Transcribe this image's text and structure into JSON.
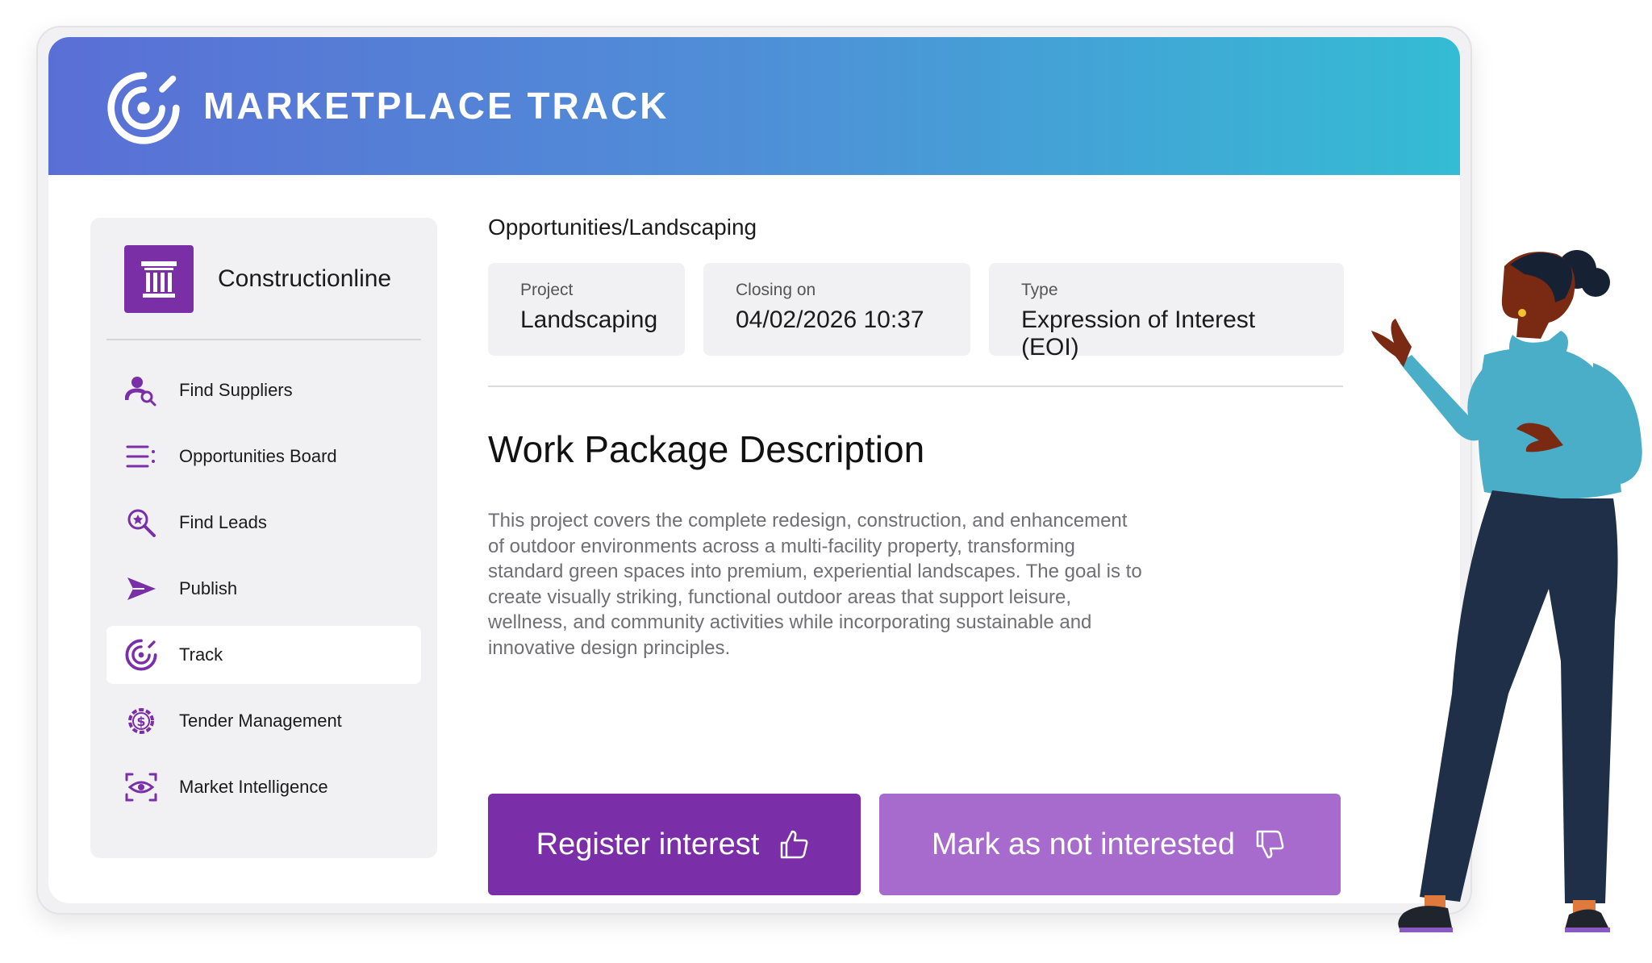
{
  "header": {
    "title": "MARKETPLACE TRACK",
    "logo_icon": "track-target-icon"
  },
  "sidebar": {
    "organization": {
      "name": "Constructionline",
      "icon": "building-columns-icon"
    },
    "items": [
      {
        "label": "Find Suppliers",
        "icon": "user-search-icon",
        "active": false
      },
      {
        "label": "Opportunities Board",
        "icon": "list-icon",
        "active": false
      },
      {
        "label": "Find Leads",
        "icon": "search-star-icon",
        "active": false
      },
      {
        "label": "Publish",
        "icon": "send-icon",
        "active": false
      },
      {
        "label": "Track",
        "icon": "track-target-icon",
        "active": true
      },
      {
        "label": "Tender Management",
        "icon": "dollar-gear-icon",
        "active": false
      },
      {
        "label": "Market Intelligence",
        "icon": "eye-scan-icon",
        "active": false
      }
    ]
  },
  "main": {
    "breadcrumb": "Opportunities/Landscaping",
    "info_cards": [
      {
        "label": "Project",
        "value": "Landscaping"
      },
      {
        "label": "Closing on",
        "value": "04/02/2026 10:37"
      },
      {
        "label": "Type",
        "value": "Expression of Interest (EOI)"
      }
    ],
    "section_title": "Work Package Description",
    "description_lines": [
      "This project covers the complete redesign, construction, and enhancement",
      "of outdoor environments across a multi-facility property, transforming",
      "standard green spaces into premium, experiential landscapes. The goal is to",
      "create visually striking, functional outdoor areas that support leisure,",
      "wellness, and community activities while incorporating sustainable and",
      "innovative design principles."
    ],
    "actions": {
      "register_label": "Register interest",
      "register_icon": "thumbs-up-icon",
      "decline_label": "Mark as not interested",
      "decline_icon": "thumbs-down-icon"
    }
  },
  "colors": {
    "header_gradient_start": "#5a6fd6",
    "header_gradient_end": "#34bcd4",
    "brand_purple": "#7a2ea8",
    "secondary_purple": "#a66bcc",
    "panel_gray": "#f1f1f3"
  }
}
